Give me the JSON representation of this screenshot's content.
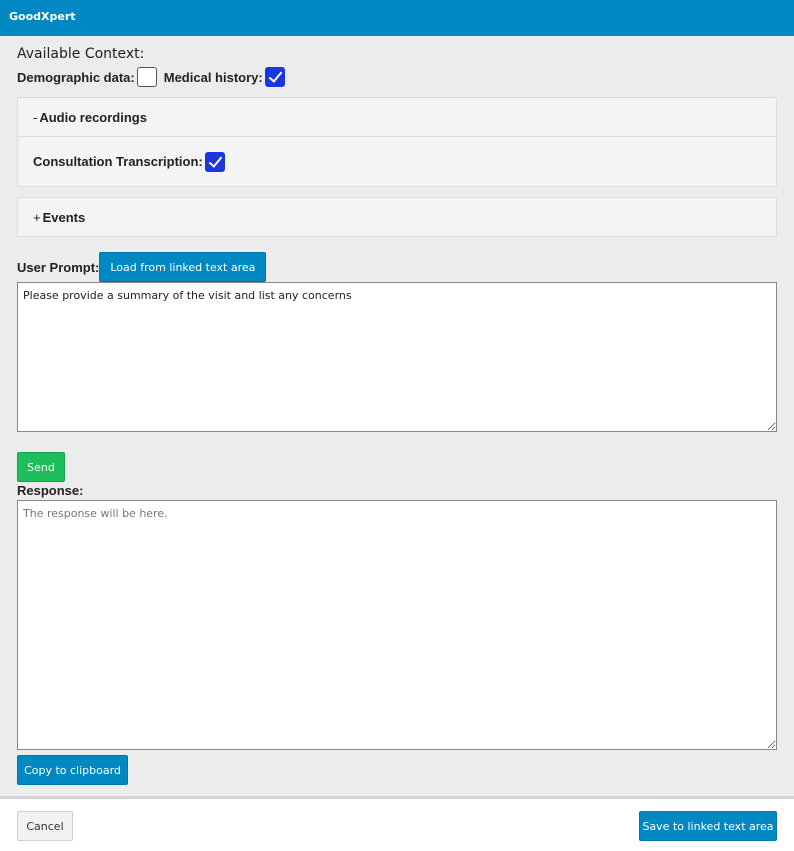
{
  "window": {
    "title": "GoodXpert"
  },
  "context": {
    "heading": "Available Context:",
    "demographic_label": "Demographic data:",
    "demographic_checked": false,
    "medical_label": "Medical history:",
    "medical_checked": true
  },
  "audio_panel": {
    "sign": "-",
    "title": "Audio recordings",
    "transcription_label": "Consultation Transcription:",
    "transcription_checked": true
  },
  "events_panel": {
    "sign": "+",
    "title": "Events"
  },
  "prompt": {
    "label": "User Prompt:",
    "load_button": "Load from linked text area",
    "value": "Please provide a summary of the visit and list any concerns"
  },
  "send_button": "Send",
  "response": {
    "label": "Response:",
    "placeholder": "The response will be here.",
    "copy_button": "Copy to clipboard"
  },
  "footer": {
    "cancel_button": "Cancel",
    "save_button": "Save to linked text area"
  },
  "colors": {
    "accent": "#0088c2",
    "send": "#1dbe5b",
    "checkbox": "#1a36e0"
  }
}
